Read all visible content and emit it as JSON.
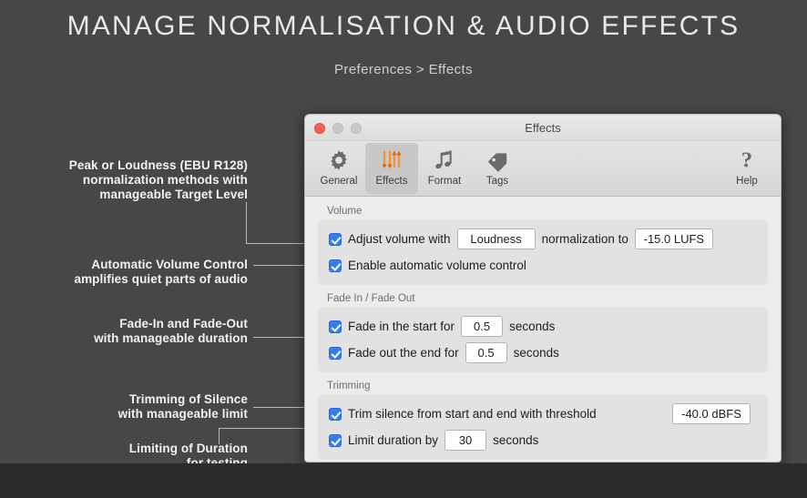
{
  "page": {
    "title": "MANAGE  NORMALISATION  &  AUDIO EFFECTS",
    "breadcrumb": "Preferences > Effects"
  },
  "annotations": [
    {
      "id": "a1",
      "text": "Peak or Loudness (EBU R128)\nnormalization methods with\nmanageable Target Level"
    },
    {
      "id": "a2",
      "text": "Automatic Volume Control\namplifies quiet parts of audio"
    },
    {
      "id": "a3",
      "text": "Fade-In and Fade-Out\nwith manageable duration"
    },
    {
      "id": "a4",
      "text": "Trimming of Silence\nwith manageable limit"
    },
    {
      "id": "a5",
      "text": "Limiting of Duration\nfor testing"
    }
  ],
  "window": {
    "title": "Effects",
    "traffic_lights": {
      "close": "close-button",
      "minimize": "minimize-button",
      "zoom": "zoom-button"
    },
    "toolbar": [
      {
        "id": "general",
        "label": "General",
        "icon": "gear-icon",
        "selected": false
      },
      {
        "id": "effects",
        "label": "Effects",
        "icon": "sliders-icon",
        "selected": true
      },
      {
        "id": "format",
        "label": "Format",
        "icon": "music-note-icon",
        "selected": false
      },
      {
        "id": "tags",
        "label": "Tags",
        "icon": "tag-icon",
        "selected": false
      },
      {
        "id": "help",
        "label": "Help",
        "icon": "question-mark-icon",
        "selected": false
      }
    ],
    "groups": {
      "volume": {
        "label": "Volume",
        "adjust": {
          "checked": true,
          "text_before": "Adjust volume with",
          "method": "Loudness",
          "text_middle": "normalization to",
          "target_level": "-15.0 LUFS"
        },
        "auto_volume": {
          "checked": true,
          "text": "Enable automatic volume control"
        }
      },
      "fade": {
        "label": "Fade In / Fade Out",
        "fade_in": {
          "checked": true,
          "text_before": "Fade in the start for",
          "value": "0.5",
          "unit": "seconds"
        },
        "fade_out": {
          "checked": true,
          "text_before": "Fade out the end for",
          "value": "0.5",
          "unit": "seconds"
        }
      },
      "trimming": {
        "label": "Trimming",
        "trim_silence": {
          "checked": true,
          "text_before": "Trim silence from start and end with threshold",
          "threshold": "-40.0 dBFS"
        },
        "limit_duration": {
          "checked": true,
          "text_before": "Limit duration by",
          "value": "30",
          "unit": "seconds"
        }
      }
    }
  },
  "colors": {
    "background": "#474747",
    "checkbox_accent": "#2f7ef5",
    "effects_icon": "#f07c1d",
    "close_button": "#f65f57"
  }
}
